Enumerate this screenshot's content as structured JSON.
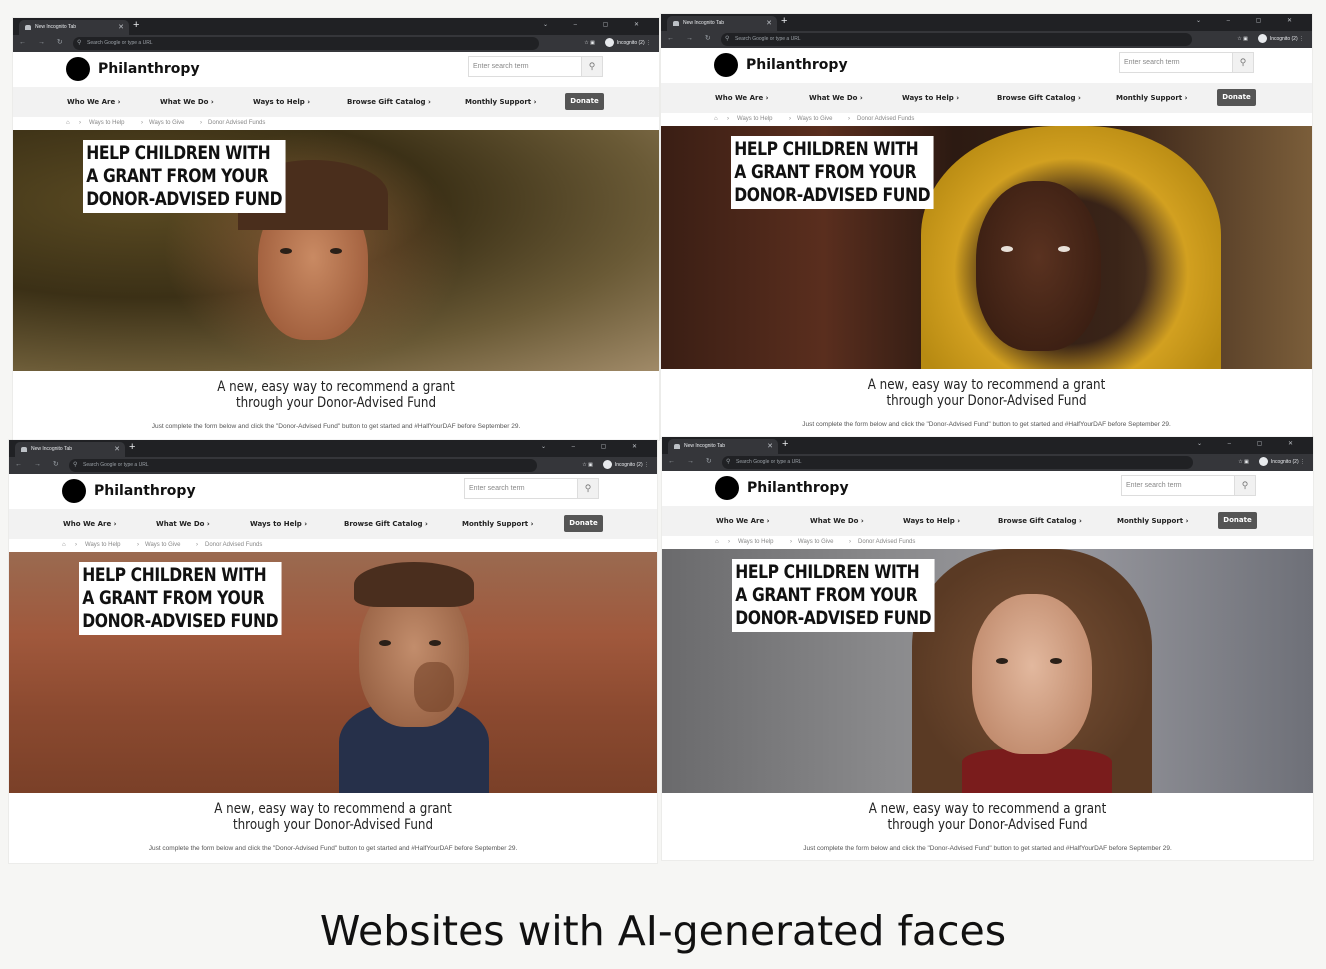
{
  "browser": {
    "tab_title": "New Incognito Tab",
    "omnibox_placeholder": "Search Google or type a URL",
    "profile_label": "Incognito (2)"
  },
  "site": {
    "logo_text": "Philanthropy",
    "search_placeholder": "Enter search term",
    "nav": [
      "Who We Are",
      "What We Do",
      "Ways to Help",
      "Browse Gift Catalog",
      "Monthly Support"
    ],
    "donate_label": "Donate",
    "breadcrumbs": [
      "Ways to Help",
      "Ways to Give",
      "Donor Advised Funds"
    ],
    "headline": [
      "HELP CHILDREN WITH",
      "A GRANT FROM YOUR",
      "DONOR-ADVISED FUND"
    ],
    "subhead": [
      "A new, easy way to recommend a grant",
      "through your Donor-Advised Fund"
    ],
    "fine_print": "Just complete the form below and click the \"Donor-Advised Fund\" button to get started and #HalfYourDAF before September 29."
  },
  "caption": "Websites with AI-generated faces",
  "colors": {
    "page_bg": "#f6f6f4",
    "chrome_bg": "#202124",
    "nav_bg": "#f2f2f2",
    "donate_bg": "#555555"
  }
}
